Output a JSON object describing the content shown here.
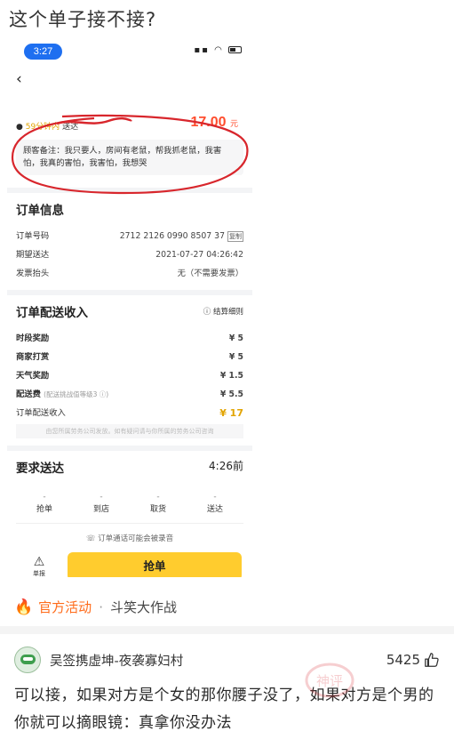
{
  "post": {
    "title": "这个单子接不接?"
  },
  "phone": {
    "status_time": "3:27",
    "order": {
      "eta": "59分钟内",
      "eta_suffix": "送达",
      "price_value": "17.00",
      "price_unit": "元",
      "customer_note": "顾客备注：我只要人，房间有老鼠，帮我抓老鼠，我害怕，我真的害怕，我害怕，我想哭"
    },
    "order_info": {
      "heading": "订单信息",
      "rows": [
        {
          "label": "订单号码",
          "value": "2712 2126 0990 8507 37",
          "action": "复制"
        },
        {
          "label": "期望送达",
          "value": "2021-07-27 04:26:42"
        },
        {
          "label": "发票抬头",
          "value": "无（不需要发票）"
        }
      ]
    },
    "income": {
      "heading": "订单配送收入",
      "detail_link": "结算细则",
      "rows": [
        {
          "label": "时段奖励",
          "value": "¥ 5"
        },
        {
          "label": "商家打赏",
          "value": "¥ 5"
        },
        {
          "label": "天气奖励",
          "value": "¥ 1.5"
        },
        {
          "label": "配送费",
          "sub": "(配送挑战值等级3 ⓘ)",
          "value": "¥ 5.5"
        },
        {
          "label": "订单配送收入",
          "value": "¥ 17"
        }
      ],
      "disclaimer": "由您所属劳务公司发放。如有疑问请与你所属的劳务公司咨询"
    },
    "delivery": {
      "heading": "要求送达",
      "time": "4:26前",
      "steps": [
        "抢单",
        "到店",
        "取货",
        "送达"
      ],
      "step_placeholder": "-",
      "record_notice": "订单通话可能会被录音",
      "single_label": "单报",
      "grab_button": "抢单"
    }
  },
  "activity": {
    "tag": "官方活动",
    "separator": "·",
    "topic": "斗笑大作战"
  },
  "comment": {
    "username": "吴签携虚坤-夜袭寡妇村",
    "likes": "5425",
    "text": "可以接，如果对方是个女的那你腰子没了，如果对方是个男的你就可以摘眼镜：真拿你没办法",
    "stamp_text": "神评"
  },
  "colors": {
    "accent_yellow": "#ffcc2e",
    "price_red": "#ff4d2e",
    "annotation_red": "#d8262c",
    "activity_orange": "#ff6b1a"
  }
}
